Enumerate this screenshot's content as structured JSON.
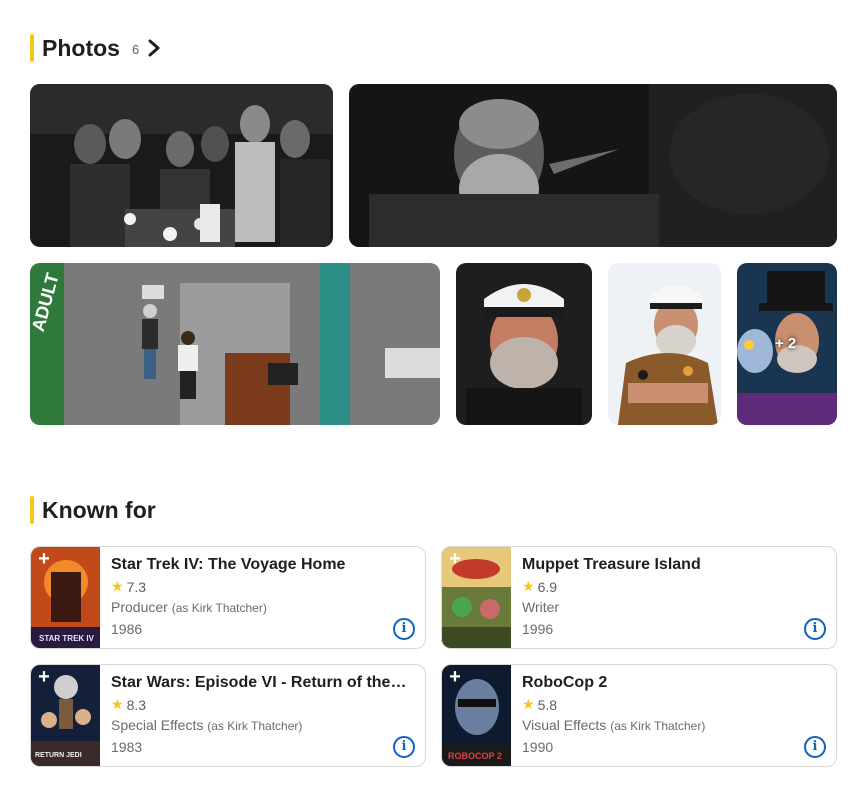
{
  "photos": {
    "title": "Photos",
    "count": "6",
    "more_badge": "+ 2",
    "items": [
      {
        "icon": "group-candles-photo"
      },
      {
        "icon": "bearded-man-night-photo"
      },
      {
        "icon": "street-aerial-photo"
      },
      {
        "icon": "captain-hat-portrait-photo"
      },
      {
        "icon": "captain-hat-arms-crossed-photo"
      },
      {
        "icon": "top-hat-muppet-photo"
      }
    ]
  },
  "known_for": {
    "title": "Known for",
    "items": [
      {
        "title": "Star Trek IV: The Voyage Home",
        "rating": "7.3",
        "role": "Producer",
        "as": "(as Kirk Thatcher)",
        "year": "1986"
      },
      {
        "title": "Muppet Treasure Island",
        "rating": "6.9",
        "role": "Writer",
        "as": "",
        "year": "1996"
      },
      {
        "title": "Star Wars: Episode VI - Return of the J...",
        "rating": "8.3",
        "role": "Special Effects",
        "as": "(as Kirk Thatcher)",
        "year": "1983"
      },
      {
        "title": "RoboCop 2",
        "rating": "5.8",
        "role": "Visual Effects",
        "as": "(as Kirk Thatcher)",
        "year": "1990"
      }
    ],
    "add_label": "+",
    "info_label": "i"
  },
  "colors": {
    "accent": "#f5c518",
    "info": "#0e63be"
  }
}
